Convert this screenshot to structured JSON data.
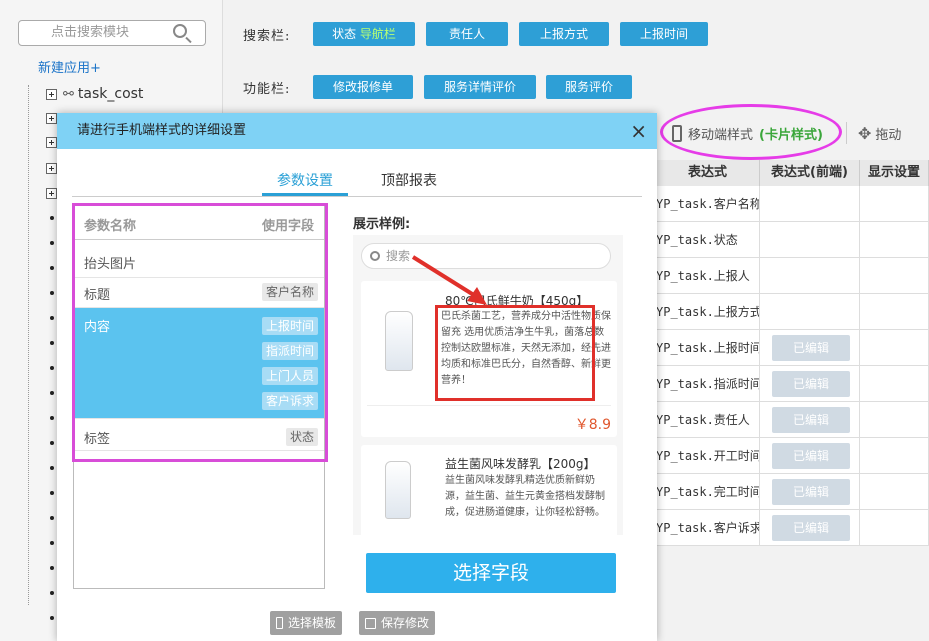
{
  "sidebar": {
    "search_placeholder": "点击搜索模块",
    "new_app": "新建应用+",
    "tree_node": "task_cost"
  },
  "toolbar": {
    "search_label": "搜索栏:",
    "search_buttons": [
      "状态",
      "责任人",
      "上报方式",
      "上报时间"
    ],
    "search_button_hl": "导航栏",
    "function_label": "功能栏:",
    "function_buttons": [
      "修改报修单",
      "服务详情评价",
      "服务评价"
    ]
  },
  "view_options": {
    "mobile_style": "移动端样式",
    "mobile_style_tag": "(卡片样式)",
    "drag": "拖动"
  },
  "table": {
    "headers": [
      "表达式",
      "表达式(前端)",
      "显示设置"
    ],
    "rows": [
      {
        "expr": "YP_task.客户名称",
        "edit": ""
      },
      {
        "expr": "YP_task.状态",
        "edit": ""
      },
      {
        "expr": "YP_task.上报人",
        "edit": ""
      },
      {
        "expr": "YP_task.上报方式",
        "edit": ""
      },
      {
        "expr": "YP_task.上报时间",
        "edit": "已编辑"
      },
      {
        "expr": "YP_task.指派时间",
        "edit": "已编辑"
      },
      {
        "expr": "YP_task.责任人",
        "edit": "已编辑"
      },
      {
        "expr": "YP_task.开工时间",
        "edit": "已编辑"
      },
      {
        "expr": "YP_task.完工时间",
        "edit": "已编辑"
      },
      {
        "expr": "YP_task.客户诉求",
        "edit": "已编辑"
      }
    ]
  },
  "modal": {
    "title": "请进行手机端样式的详细设置",
    "close": "×",
    "tabs": [
      "参数设置",
      "顶部报表"
    ],
    "param_header": {
      "name": "参数名称",
      "field": "使用字段"
    },
    "params": {
      "header_image": "抬头图片",
      "title": "标题",
      "title_field": "客户名称",
      "content": "内容",
      "content_fields": [
        "上报时间",
        "指派时间",
        "上门人员",
        "客户诉求"
      ],
      "label": "标签",
      "label_field": "状态"
    },
    "sample_label": "展示样例:",
    "sample_search": "搜索",
    "products": [
      {
        "title": "80℃巴氏鲜牛奶【450g】",
        "desc": "巴氏杀菌工艺，营养成分中活性物质保留充 选用优质洁净生牛乳，菌落总数控制达欧盟标准，天然无添加，经先进均质和标准巴氏分，自然香醇、新鲜更营养！",
        "price": "￥8.9"
      },
      {
        "title": "益生菌风味发酵乳【200g】",
        "desc": "益生菌风味发酵乳精选优质新鲜奶源，益生菌、益生元黄金搭档发酵制成，促进肠道健康，让你轻松舒畅。"
      }
    ],
    "select_field": "选择字段",
    "choose_template": "选择模板",
    "save_changes": "保存修改"
  }
}
